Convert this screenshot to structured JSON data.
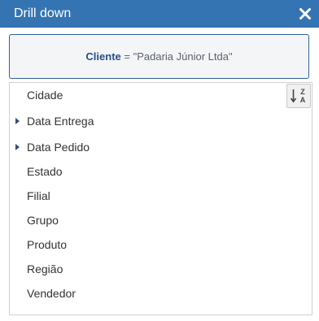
{
  "dialog": {
    "title": "Drill down",
    "close_icon": "close-icon",
    "accent_color": "#3574b3"
  },
  "filter": {
    "field": "Cliente",
    "operator": "=",
    "value": "\"Padaria Júnior Ltda\""
  },
  "list": {
    "sort_icon": "sort-z-a-icon",
    "items": [
      {
        "label": "Cidade",
        "expandable": false
      },
      {
        "label": "Data Entrega",
        "expandable": true
      },
      {
        "label": "Data Pedido",
        "expandable": true
      },
      {
        "label": "Estado",
        "expandable": false
      },
      {
        "label": "Filial",
        "expandable": false
      },
      {
        "label": "Grupo",
        "expandable": false
      },
      {
        "label": "Produto",
        "expandable": false
      },
      {
        "label": "Região",
        "expandable": false
      },
      {
        "label": "Vendedor",
        "expandable": false
      }
    ]
  }
}
